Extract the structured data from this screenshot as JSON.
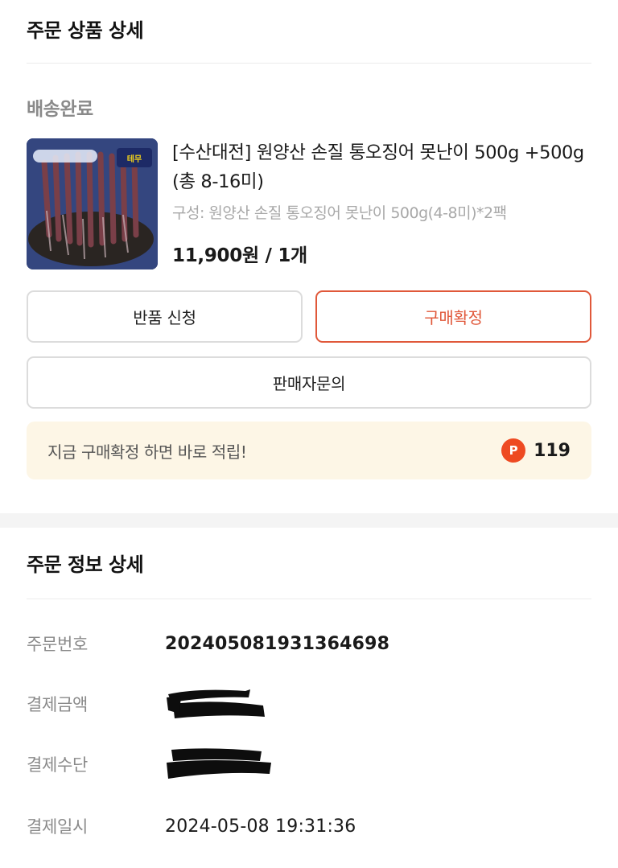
{
  "order_product": {
    "title": "주문 상품 상세",
    "status": "배송완료",
    "product_name": "[수산대전] 원양산 손질 통오징어 못난이 500g +500g (총 8-16미)",
    "option": "구성: 원양산 손질 통오징어 못난이 500g(4-8미)*2팩",
    "price": "11,900원 / 1개",
    "thumbnail_icon": "squid-product-image"
  },
  "actions": {
    "return_label": "반품 신청",
    "confirm_label": "구매확정",
    "inquiry_label": "판매자문의"
  },
  "reward": {
    "message": "지금 구매확정 하면 바로 적립!",
    "icon_letter": "P",
    "points": "119"
  },
  "order_info": {
    "title": "주문 정보 상세",
    "rows": [
      {
        "label": "주문번호",
        "value": "2024050819313 64698"
      },
      {
        "label": "결제금액",
        "value": ""
      },
      {
        "label": "결제수단",
        "value": ""
      },
      {
        "label": "결제일시",
        "value": "2024-05-08 19:31:36"
      }
    ]
  },
  "colors": {
    "accent": "#e0583a",
    "point_badge": "#ee4a22",
    "reward_bg": "#fdf6e6"
  }
}
